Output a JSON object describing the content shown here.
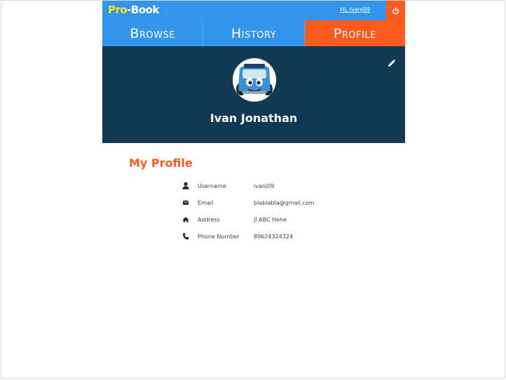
{
  "header": {
    "logo_pro": "Pro",
    "logo_book": "-Book",
    "greeting": "Hi, ivanj09",
    "logout_icon": "power-icon"
  },
  "tabs": [
    {
      "label": "Browse",
      "active": false
    },
    {
      "label": "History",
      "active": false
    },
    {
      "label": "Profile",
      "active": true
    }
  ],
  "hero": {
    "name": "Ivan Jonathan",
    "avatar": "bus-character-avatar",
    "edit_icon": "pencil-icon"
  },
  "profile": {
    "title": "My Profile",
    "fields": [
      {
        "icon": "user-icon",
        "label": "Username",
        "value": "ivanj09"
      },
      {
        "icon": "envelope-icon",
        "label": "Email",
        "value": "blablabla@gmail.com"
      },
      {
        "icon": "home-icon",
        "label": "Address",
        "value": "Jl ABC Hehe"
      },
      {
        "icon": "phone-icon",
        "label": "Phone Number",
        "value": "89624324324"
      }
    ]
  },
  "colors": {
    "topbar": "#3394eb",
    "accent": "#ff5a1e",
    "hero": "#0f3a52",
    "logo_yellow": "#f3e81a"
  }
}
